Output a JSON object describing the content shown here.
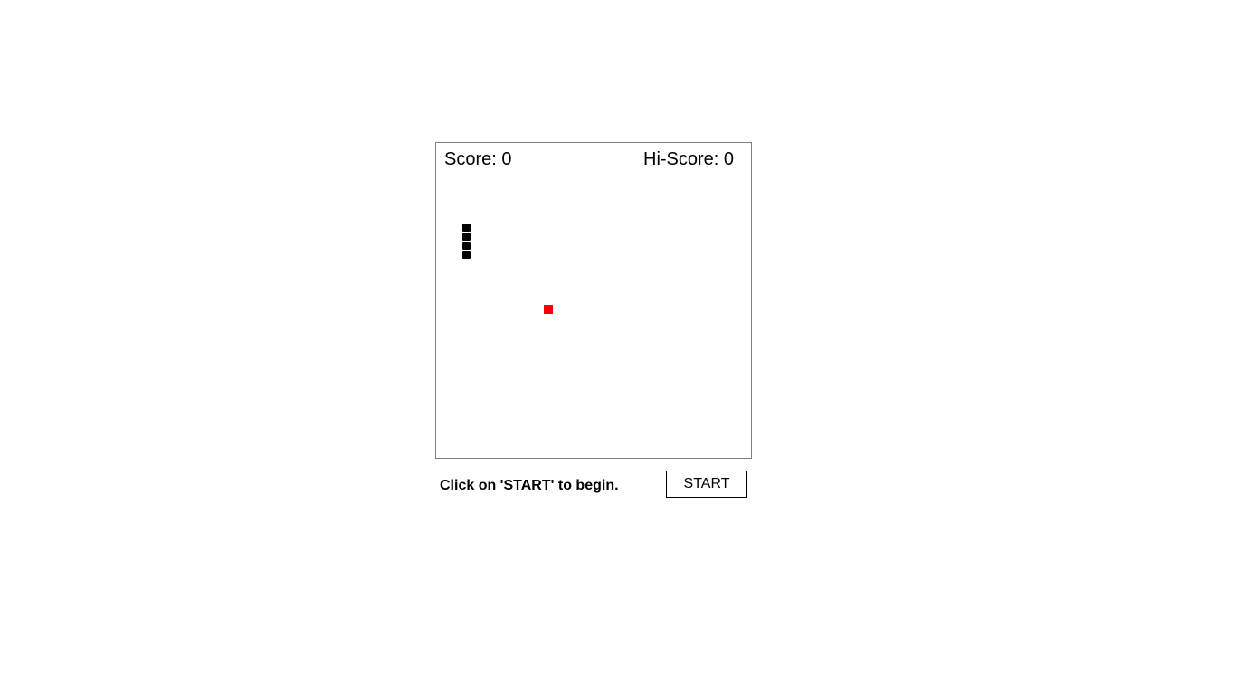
{
  "scoreboard": {
    "score_label": "Score: 0",
    "hiscore_label": "Hi-Score: 0"
  },
  "game": {
    "score": 0,
    "hi_score": 0,
    "snake_color": "#000000",
    "food_color": "#ff0000"
  },
  "controls": {
    "status_text": "Click on 'START' to begin.",
    "start_label": "START"
  }
}
